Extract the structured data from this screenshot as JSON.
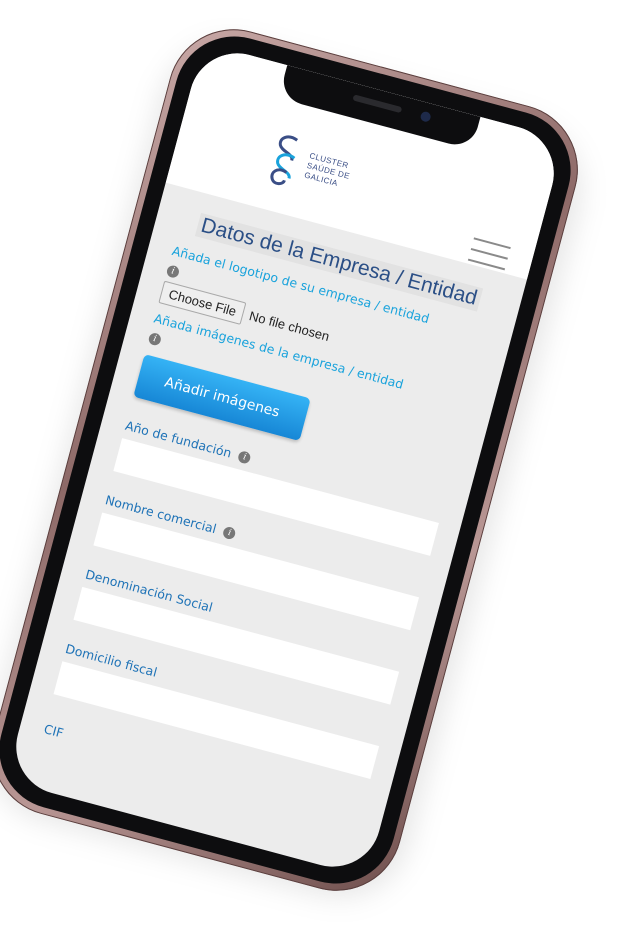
{
  "header": {
    "logo": {
      "line1": "CLUSTER",
      "line2": "SAÚDE DE",
      "line3": "GALICIA",
      "mark_color": "#3a4e86",
      "accent_color": "#1aa3dc"
    },
    "menu_icon": "hamburger-menu-icon"
  },
  "form": {
    "title": "Datos de la Empresa / Entidad",
    "logo_label": "Añada el logotipo de su empresa / entidad",
    "choose_file_label": "Choose File",
    "no_file_text": "No file chosen",
    "images_label": "Añada imágenes de la empresa / entidad",
    "add_images_button": "Añadir imágenes",
    "fields": [
      {
        "label": "Año de fundación",
        "has_info": true,
        "value": ""
      },
      {
        "label": "Nombre comercial",
        "has_info": true,
        "value": ""
      },
      {
        "label": "Denominación Social",
        "has_info": false,
        "value": ""
      },
      {
        "label": "Domicilio fiscal",
        "has_info": false,
        "value": ""
      }
    ],
    "cif_label": "CIF"
  },
  "colors": {
    "title": "#2b4f86",
    "label_light": "#1aa3dc",
    "label_dark": "#1f73b7",
    "button": "#1e94e0",
    "screen_bg": "#ececec"
  }
}
